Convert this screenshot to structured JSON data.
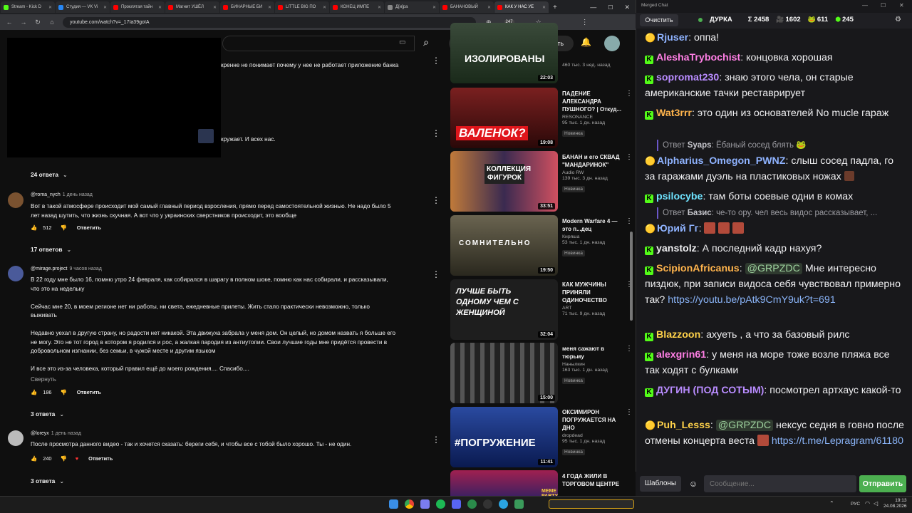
{
  "browser": {
    "tabs": [
      {
        "label": "Stream - Kick D",
        "color": "#53fc18"
      },
      {
        "label": "Студия — VK Vi",
        "color": "#2787f5"
      },
      {
        "label": "Проклятая тайн",
        "color": "#ff0000"
      },
      {
        "label": "Магнит УШЁЛ",
        "color": "#ff0000"
      },
      {
        "label": "БИНАРНЫЕ БИ",
        "color": "#ff0000"
      },
      {
        "label": "LITTLE BIG ПО",
        "color": "#ff0000"
      },
      {
        "label": "КОНЕЦ ИМПЕ",
        "color": "#ff0000"
      },
      {
        "label": "Д[и]ра",
        "color": "#888888"
      },
      {
        "label": "БАНАНОВЫЙ",
        "color": "#ff0000"
      },
      {
        "label": "КАК У НАС УЕ",
        "color": "#ff0000"
      }
    ],
    "url": "youtube.com/watch?v=_17Ia39goIA",
    "ext_badge": "247"
  },
  "youtube": {
    "create_label": "Создать",
    "comments": [
      {
        "partial_text_1": "кренне не понимает почему у нее не работает приложение банка",
        "partial_text_2": "кружает. И всех нас."
      },
      {
        "replies": "24 ответа"
      },
      {
        "author": "@roma_nych",
        "time": "1 день назад",
        "lines": [
          "Вот в такой атмосфере происходит мой самый главный период взросления, прямо перед самостоятельной жизнью. Не надо было 5",
          "лет назад шутить, что жизнь скучная.  А вот что у украинских сверстников происходит, это вообще"
        ],
        "likes": "512",
        "reply": "Ответить",
        "replies": "17 ответов"
      },
      {
        "author": "@mirage.project",
        "time": "9 часов назад",
        "lines": [
          "В 22 году мне было 16, помню утро 24 февраля, как собирался в шарагу в полном шоке, помню как нас собирали, и рассказывали,",
          "что это на недельку",
          "",
          "Сейчас мне 20, в моем регионе нет ни работы, ни света, ежедневные прилеты. Жить стало практически невозможно, только",
          "выживать",
          "",
          "Недавно уехал в другую страну, но радости нет никакой. Эта движуха забрала у меня дом. Он целый, но домом назвать я больше его",
          "не могу. Это не тот город в котором я родился и рос, а жалкая пародия из антиутопии. Свои лучшие годы мне придётся провести в",
          "добровольном изгнании, без семьи, в чужой месте и другим языком",
          "",
          "И все это из-за человека, который правил ещё до моего рождения.... Спасибо...."
        ],
        "collapse": "Свернуть",
        "likes": "186",
        "reply": "Ответить",
        "replies": "3 ответа"
      },
      {
        "author": "@loreyx",
        "time": "1 день назад",
        "lines": [
          "После просмотра данного видео - так и хочется сказать: береги себя, и чтобы все с тобой было хорошо. Ты - не один."
        ],
        "likes": "240",
        "reply": "Ответить",
        "replies": "3 ответа"
      }
    ],
    "sidebar": [
      {
        "thumb_text": "ИЗОЛИРОВАНЫ",
        "duration": "22:03",
        "title": "",
        "channel": "",
        "meta": "460 тыс.   3 нед. назад",
        "new": ""
      },
      {
        "thumb_text": "ВАЛЕНОК?",
        "duration": "19:08",
        "title": "ПАДЕНИЕ АЛЕКСАНДРА ПУШНОГО? | Откуд...",
        "channel": "RESONANCE",
        "meta": "95 тыс.   1 дн. назад",
        "new": "Новинка"
      },
      {
        "thumb_text": "КОЛЛЕКЦИЯ ФИГУРОК",
        "duration": "33:51",
        "title": "БАНАН и его СКВАД \"МАНДАРИНОК\"",
        "channel": "Audio RW",
        "meta": "139 тыс.   3 дн. назад",
        "new": "Новинка"
      },
      {
        "thumb_text": "СОМНИТЕЛЬНО",
        "duration": "19:50",
        "title": "Modern Warfare 4 — это п...дец",
        "channel": "Киряша",
        "meta": "53 тыс.   1 дн. назад",
        "new": "Новинка"
      },
      {
        "thumb_text": "ЛУЧШЕ БЫТЬ ОДНОМУ ЧЕМ С ЖЕНЩИНОЙ",
        "duration": "32:04",
        "title": "КАК МУЖЧИНЫ ПРИНЯЛИ ОДИНОЧЕСТВО",
        "channel": "ART",
        "meta": "71 тыс.   9 дн. назад",
        "new": ""
      },
      {
        "thumb_text": "",
        "duration": "15:00",
        "title": "меня сажают в тюрьму",
        "channel": "Нанылкин",
        "meta": "163 тыс.   1 дн. назад",
        "new": "Новинка"
      },
      {
        "thumb_text": "#ПОГРУЖЕНИЕ",
        "duration": "11:41",
        "title": "ОКСИМИРОН ПОГРУЖАЕТСЯ НА ДНО",
        "channel": "dropdead",
        "meta": "95 тыс.   1 дн. назад",
        "new": "Новинка"
      },
      {
        "thumb_text": "MEME PARTY",
        "duration": "",
        "title": "4 ГОДА ЖИЛИ В ТОРГОВОМ ЦЕНТРЕ",
        "channel": "",
        "meta": "",
        "new": ""
      }
    ]
  },
  "chat": {
    "window_title": "Merged Chat",
    "clear": "Очистить",
    "channel": "ДУРКА",
    "stats": [
      "Σ 2458",
      "1602",
      "611",
      "245"
    ],
    "messages": [
      {
        "platform": "yt",
        "user": "Rjuser",
        "color": "#8fb3ff",
        "text": "оппа!"
      },
      {
        "platform": "kick",
        "user": "AleshaTrybochist",
        "color": "#ff7fe5",
        "text": "концовка хорошая"
      },
      {
        "platform": "kick",
        "user": "sopromat230",
        "color": "#b98cff",
        "text": "знаю этого чела, он старые американские тачки реставрирует"
      },
      {
        "platform": "kick",
        "user": "Wat3rrr",
        "color": "#ffb44c",
        "text": "это один из основателей No mucle гараж"
      },
      {
        "reply_label": "Ответ",
        "reply_user": "Syaps",
        "reply_text": "Ёбаный сосед блять"
      },
      {
        "platform": "yt",
        "user": "Alpharius_Omegon_PWNZ",
        "color": "#8fb3ff",
        "text": "слыш сосед падла, го за гаражами дуэль на пластиковых ножах"
      },
      {
        "platform": "kick",
        "user": "psilocybe",
        "color": "#6fe3ff",
        "text": "там боты соевые одни в комах"
      },
      {
        "reply_label": "Ответ",
        "reply_user": "Базис",
        "reply_text": "че-то ору. чел весь видос рассказывает, ..."
      },
      {
        "platform": "yt",
        "user": "Юрий Гг",
        "color": "#8fb3ff",
        "text": ""
      },
      {
        "platform": "kick",
        "user": "yanstolz",
        "color": "#efeff1",
        "text": "А последний кадр нахуя?"
      },
      {
        "platform": "kick",
        "user": "ScipionAfricanus",
        "color": "#ffb44c",
        "mention": "@GRPZDC",
        "text": "Мне интересно пиздюк, при записи видоса себя чувствовал примерно так?",
        "link": "https://youtu.be/pAtk9CmY9uk?t=691"
      },
      {
        "platform": "kick",
        "user": "Blazzoon",
        "color": "#ffd24a",
        "text": "ахуеть , а что за базовый рилс"
      },
      {
        "platform": "kick",
        "user": "alexgrin61",
        "color": "#ff7fe5",
        "text": "у меня на море тоже возле пляжа все так ходят с булками"
      },
      {
        "platform": "kick",
        "user": "ДУГИН (ПОД СОТЫМ)",
        "color": "#b98cff",
        "text": "посмотрел артхаус какой-то"
      },
      {
        "platform": "yt",
        "user": "Puh_Lesss",
        "color": "#ffd24a",
        "mention": "@GRPZDC",
        "text": "нексус седня в говно после отмены концерта веста",
        "link": "https://t.me/Lepragram/61180"
      }
    ],
    "templates": "Шаблоны",
    "input_placeholder": "Сообщение...",
    "send": "Отправить"
  },
  "taskbar": {
    "lang": "РУС",
    "time": "19:13",
    "date": "24.08.2026"
  }
}
